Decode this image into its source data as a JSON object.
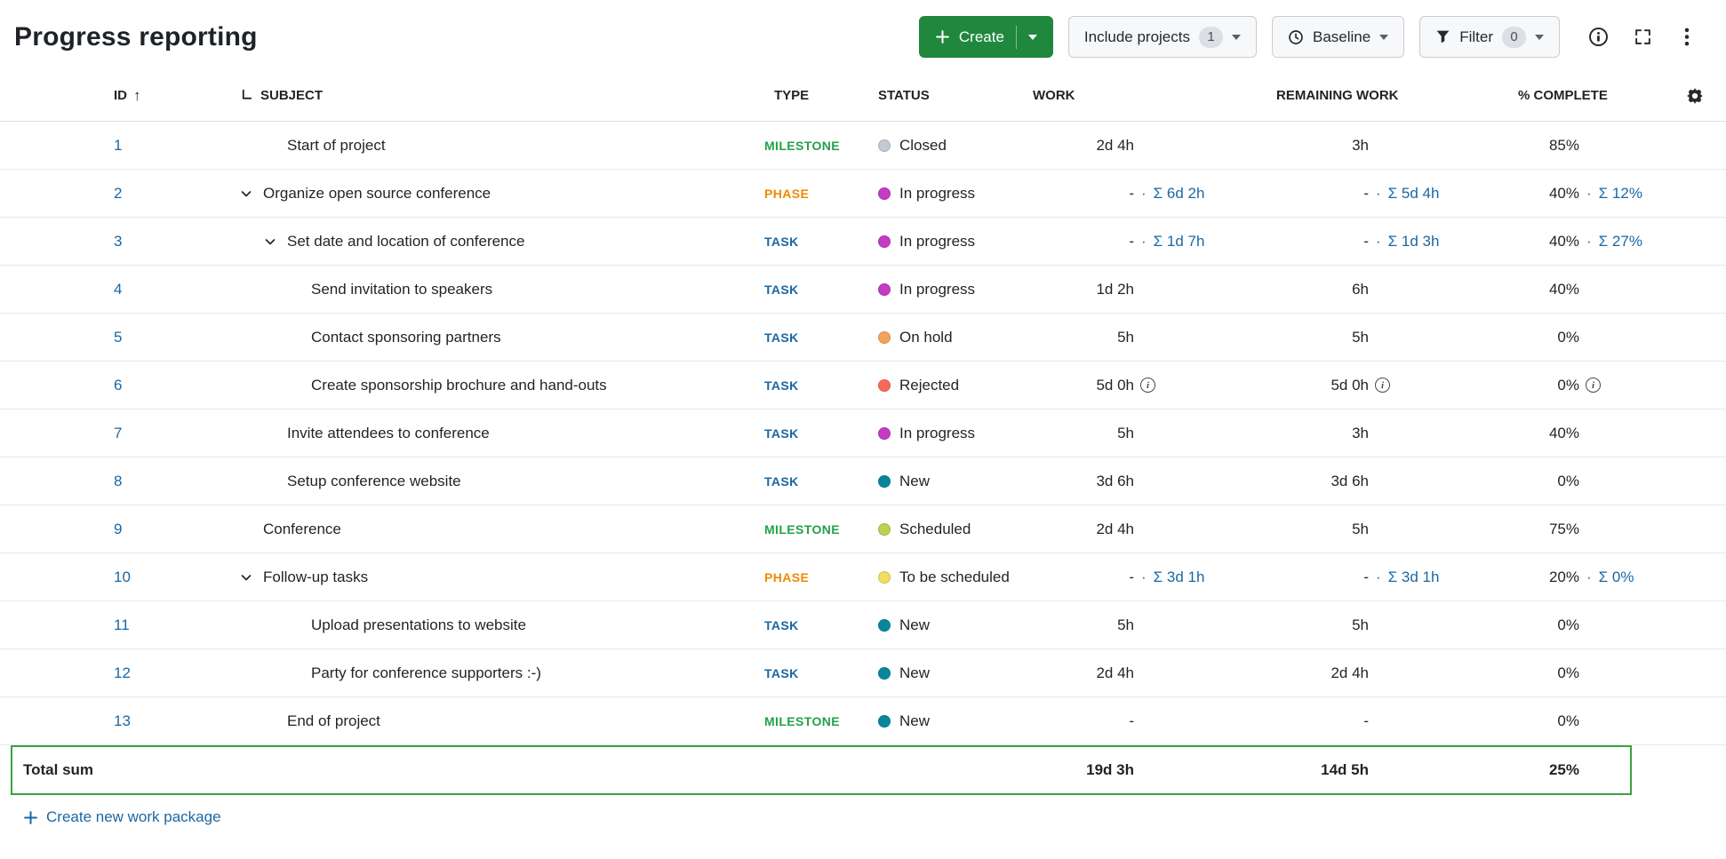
{
  "page": {
    "title": "Progress reporting"
  },
  "toolbar": {
    "create_label": "Create",
    "include_projects_label": "Include projects",
    "include_projects_count": "1",
    "baseline_label": "Baseline",
    "filter_label": "Filter",
    "filter_count": "0"
  },
  "icons": {
    "sort_ascending": "↑"
  },
  "colors": {
    "link": "#1A67A3",
    "create_button": "#1F883D",
    "total_border": "#3BA23F",
    "type": {
      "MILESTONE": "#24A148",
      "PHASE": "#F08A00",
      "TASK": "#1A67A3"
    },
    "status": {
      "Closed": "#C3CAD2",
      "In progress": "#C63AC4",
      "On hold": "#F6A358",
      "Rejected": "#F7695C",
      "New": "#08879B",
      "Scheduled": "#BCD250",
      "To be scheduled": "#F1DE60"
    }
  },
  "table": {
    "columns": {
      "id": "ID",
      "subject": "SUBJECT",
      "type": "TYPE",
      "status": "STATUS",
      "work": "WORK",
      "remaining_work": "REMAINING WORK",
      "percent_complete": "% COMPLETE"
    },
    "sum_separator": "·",
    "rows": [
      {
        "id": "1",
        "subject": "Start of project",
        "indent": 2,
        "chevron": false,
        "type": "MILESTONE",
        "status": "Closed",
        "work": "2d 4h",
        "remaining": "3h",
        "percent": "85%"
      },
      {
        "id": "2",
        "subject": "Organize open source conference",
        "indent": 0,
        "chevron": true,
        "type": "PHASE",
        "status": "In progress",
        "work": "-",
        "work_sum": "Σ 6d 2h",
        "remaining": "-",
        "remaining_sum": "Σ 5d 4h",
        "percent": "40%",
        "percent_sum": "Σ 12%"
      },
      {
        "id": "3",
        "subject": "Set date and location of conference",
        "indent": 1,
        "chevron": true,
        "type": "TASK",
        "status": "In progress",
        "work": "-",
        "work_sum": "Σ 1d 7h",
        "remaining": "-",
        "remaining_sum": "Σ 1d 3h",
        "percent": "40%",
        "percent_sum": "Σ 27%"
      },
      {
        "id": "4",
        "subject": "Send invitation to speakers",
        "indent": 3,
        "chevron": false,
        "type": "TASK",
        "status": "In progress",
        "work": "1d 2h",
        "remaining": "6h",
        "percent": "40%"
      },
      {
        "id": "5",
        "subject": "Contact sponsoring partners",
        "indent": 3,
        "chevron": false,
        "type": "TASK",
        "status": "On hold",
        "work": "5h",
        "remaining": "5h",
        "percent": "0%"
      },
      {
        "id": "6",
        "subject": "Create sponsorship brochure and hand-outs",
        "indent": 3,
        "chevron": false,
        "type": "TASK",
        "status": "Rejected",
        "work": "5d 0h",
        "work_info": true,
        "remaining": "5d 0h",
        "remaining_info": true,
        "percent": "0%",
        "percent_info": true
      },
      {
        "id": "7",
        "subject": "Invite attendees to conference",
        "indent": 2,
        "chevron": false,
        "type": "TASK",
        "status": "In progress",
        "work": "5h",
        "remaining": "3h",
        "percent": "40%"
      },
      {
        "id": "8",
        "subject": "Setup conference website",
        "indent": 2,
        "chevron": false,
        "type": "TASK",
        "status": "New",
        "work": "3d 6h",
        "remaining": "3d 6h",
        "percent": "0%"
      },
      {
        "id": "9",
        "subject": "Conference",
        "indent": 1,
        "chevron": false,
        "type": "MILESTONE",
        "status": "Scheduled",
        "work": "2d 4h",
        "remaining": "5h",
        "percent": "75%"
      },
      {
        "id": "10",
        "subject": "Follow-up tasks",
        "indent": 0,
        "chevron": true,
        "type": "PHASE",
        "status": "To be scheduled",
        "work": "-",
        "work_sum": "Σ 3d 1h",
        "remaining": "-",
        "remaining_sum": "Σ 3d 1h",
        "percent": "20%",
        "percent_sum": "Σ 0%"
      },
      {
        "id": "11",
        "subject": "Upload presentations to website",
        "indent": 3,
        "chevron": false,
        "type": "TASK",
        "status": "New",
        "work": "5h",
        "remaining": "5h",
        "percent": "0%"
      },
      {
        "id": "12",
        "subject": "Party for conference supporters :-)",
        "indent": 3,
        "chevron": false,
        "type": "TASK",
        "status": "New",
        "work": "2d 4h",
        "remaining": "2d 4h",
        "percent": "0%"
      },
      {
        "id": "13",
        "subject": "End of project",
        "indent": 2,
        "chevron": false,
        "type": "MILESTONE",
        "status": "New",
        "work": "-",
        "remaining": "-",
        "percent": "0%"
      }
    ],
    "total": {
      "label": "Total sum",
      "work": "19d 3h",
      "remaining_work": "14d 5h",
      "percent_complete": "25%"
    }
  },
  "footer": {
    "create_work_package": "Create new work package"
  }
}
